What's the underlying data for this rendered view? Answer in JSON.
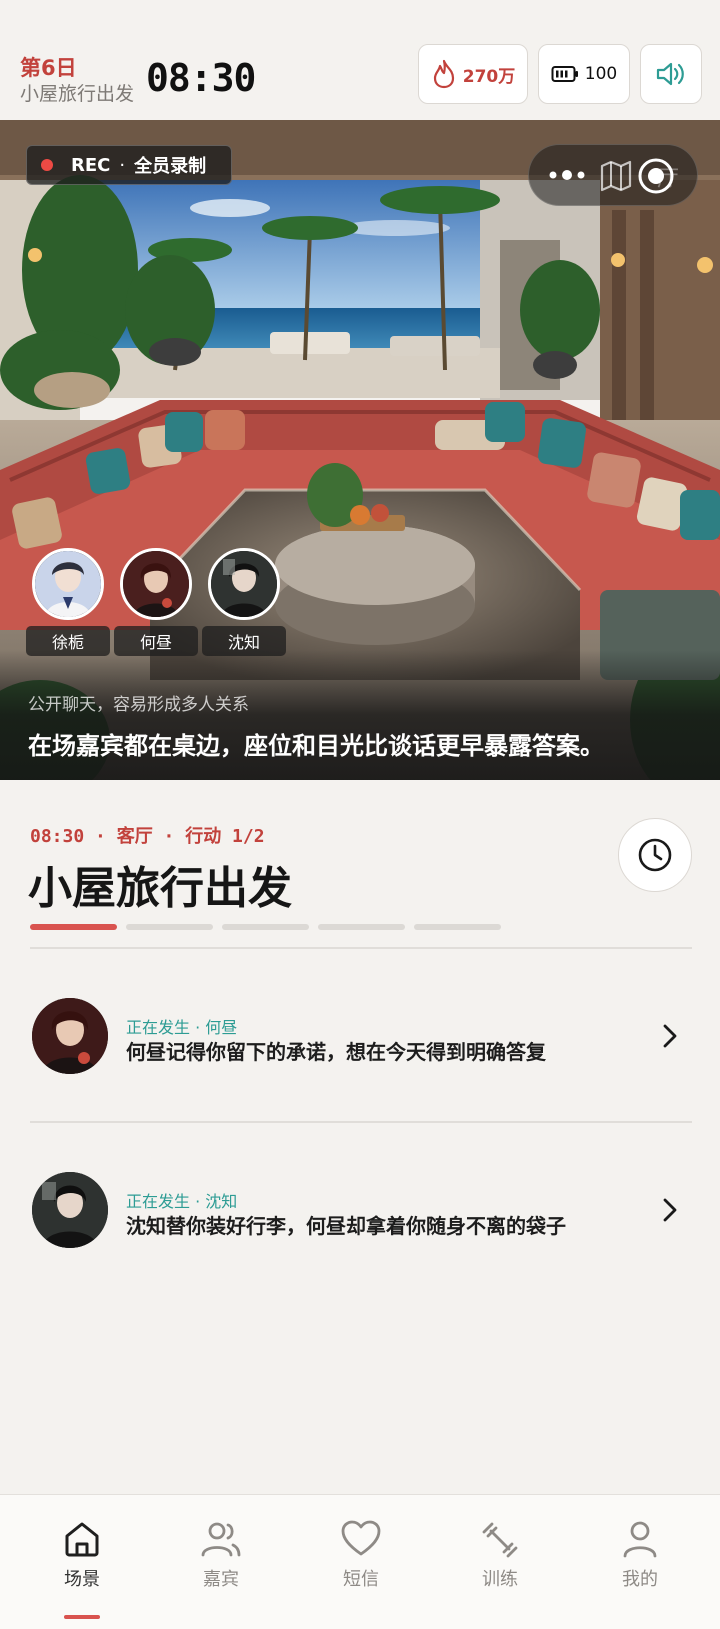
{
  "header": {
    "day_label": "第6日",
    "day_subtitle": "小屋旅行出发",
    "time": "08:30",
    "heat_value": "270万",
    "battery_value": "100",
    "accent_color": "#c2423c",
    "teal_color": "#2d9c94"
  },
  "hero": {
    "rec_label": "REC",
    "rec_separator": "·",
    "rec_mode": "全员录制",
    "ghost_label": "厅",
    "tools": [
      "more-icon",
      "map-icon",
      "target-icon"
    ],
    "guests": [
      {
        "name": "徐栀"
      },
      {
        "name": "何昼"
      },
      {
        "name": "沈知"
      }
    ],
    "caption_sub": "公开聊天，容易形成多人关系",
    "caption_main": "在场嘉宾都在桌边，座位和目光比谈话更早暴露答案。"
  },
  "scene": {
    "meta": "08:30 · 客厅 · 行动 1/2",
    "title": "小屋旅行出发",
    "progress_total": 5,
    "progress_current": 1
  },
  "events": [
    {
      "tag": "正在发生 · 何昼",
      "text": "何昼记得你留下的承诺，想在今天得到明确答复"
    },
    {
      "tag": "正在发生 · 沈知",
      "text": "沈知替你装好行李，何昼却拿着你随身不离的袋子"
    }
  ],
  "nav": {
    "items": [
      {
        "label": "场景",
        "icon": "home-icon",
        "active": true
      },
      {
        "label": "嘉宾",
        "icon": "users-icon",
        "active": false
      },
      {
        "label": "短信",
        "icon": "heart-icon",
        "active": false
      },
      {
        "label": "训练",
        "icon": "dumbbell-icon",
        "active": false
      },
      {
        "label": "我的",
        "icon": "user-icon",
        "active": false
      }
    ]
  }
}
